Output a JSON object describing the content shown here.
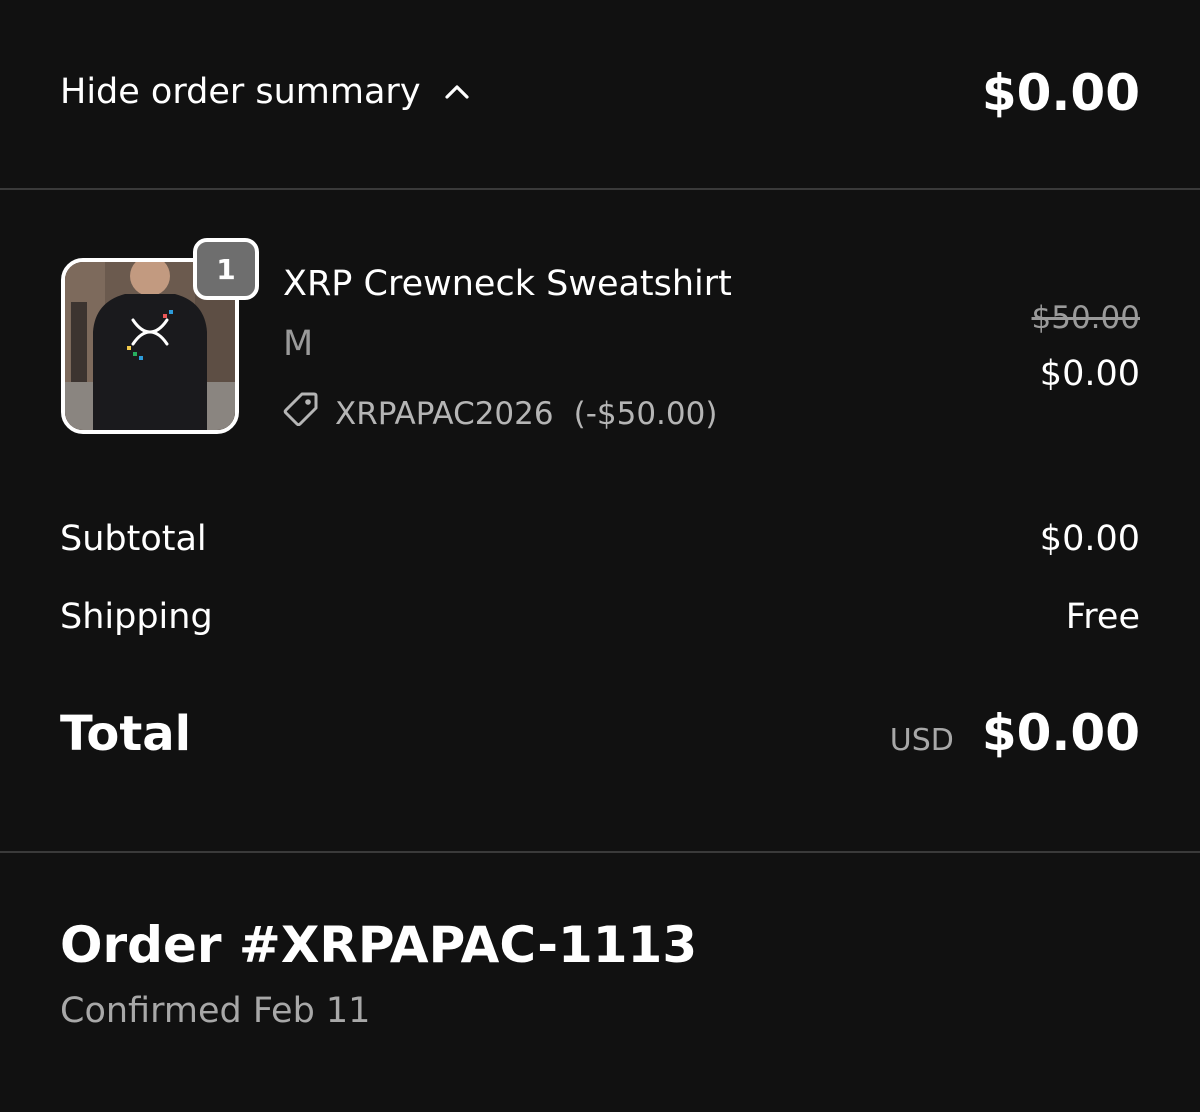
{
  "summary": {
    "toggle_label": "Hide order summary",
    "toggle_icon": "chevron-up-icon",
    "header_total": "$0.00"
  },
  "line_items": [
    {
      "quantity": "1",
      "name": "XRP Crewneck Sweatshirt",
      "variant": "M",
      "discount_icon": "tag-icon",
      "discount_code": "XRPAPAC2026",
      "discount_amount": "(-$50.00)",
      "original_price": "$50.00",
      "price": "$0.00"
    }
  ],
  "totals": {
    "subtotal_label": "Subtotal",
    "subtotal_value": "$0.00",
    "shipping_label": "Shipping",
    "shipping_value": "Free",
    "total_label": "Total",
    "currency": "USD",
    "total_value": "$0.00"
  },
  "order": {
    "number": "Order #XRPAPAC-1113",
    "status": "Confirmed Feb 11"
  },
  "colors": {
    "background": "#111111",
    "text": "#ffffff",
    "muted_text": "#9a9a9a",
    "divider": "#3a3a3a",
    "badge": "#6e6e6e"
  }
}
